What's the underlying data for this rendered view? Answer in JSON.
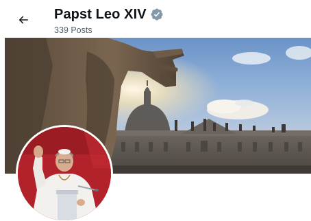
{
  "header": {
    "profile_name": "Papst Leo XIV",
    "post_count": "339 Posts",
    "back_icon": "arrow-left-icon",
    "verified_icon": "verified-badge-icon",
    "verified_color": "#829aab"
  },
  "banner": {
    "image": "st-peters-basilica-photo"
  },
  "avatar": {
    "image": "profile-photo"
  }
}
